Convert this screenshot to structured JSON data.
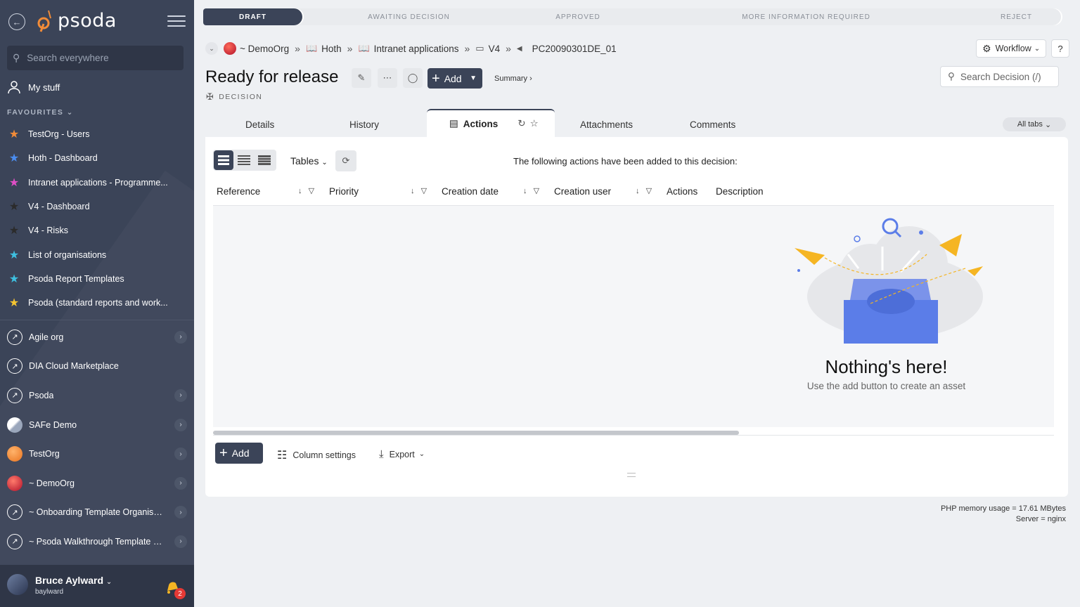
{
  "app": {
    "logo_text": "psoda"
  },
  "sidebar": {
    "search_placeholder": "Search everywhere",
    "my_stuff": "My stuff",
    "favourites_heading": "FAVOURITES",
    "favourites": [
      {
        "label": "TestOrg - Users",
        "star_color": "#f28c38"
      },
      {
        "label": "Hoth - Dashboard",
        "star_color": "#4a8df0"
      },
      {
        "label": "Intranet applications - Programme...",
        "star_color": "#e04fc6"
      },
      {
        "label": "V4 - Dashboard",
        "star_color": "#2b2b2b"
      },
      {
        "label": "V4 - Risks",
        "star_color": "#2b2b2b"
      },
      {
        "label": "List of organisations",
        "star_color": "#3ec0e0"
      },
      {
        "label": "Psoda Report Templates",
        "star_color": "#3ec0e0"
      },
      {
        "label": "Psoda (standard reports and work...",
        "star_color": "#f5c531"
      }
    ],
    "orgs": [
      {
        "label": "Agile org",
        "icon": "compass-icon",
        "has_chevron": true
      },
      {
        "label": "DIA Cloud Marketplace",
        "icon": "compass-icon",
        "has_chevron": false
      },
      {
        "label": "Psoda",
        "icon": "compass-icon",
        "has_chevron": true
      },
      {
        "label": "SAFe Demo",
        "icon": "safe-logo-icon",
        "has_chevron": true
      },
      {
        "label": "TestOrg",
        "icon": "orange-ball-icon",
        "has_chevron": true
      },
      {
        "label": "~ DemoOrg",
        "icon": "red-ball-icon",
        "has_chevron": true
      },
      {
        "label": "~ Onboarding Template Organisa...",
        "icon": "compass-icon",
        "has_chevron": true
      },
      {
        "label": "~ Psoda Walkthrough Template P...",
        "icon": "compass-icon",
        "has_chevron": true
      }
    ],
    "user": {
      "name": "Bruce Aylward",
      "username": "baylward",
      "notifications": "2"
    }
  },
  "workflow": {
    "steps": [
      "DRAFT",
      "AWAITING DECISION",
      "APPROVED",
      "MORE INFORMATION REQUIRED",
      "REJECT"
    ],
    "active": "DRAFT"
  },
  "breadcrumb": {
    "items": [
      "~ DemoOrg",
      "Hoth",
      "Intranet applications",
      "V4"
    ],
    "current": "PC20090301DE_01"
  },
  "header": {
    "workflow_button": "Workflow",
    "help": "?",
    "title": "Ready for release",
    "add_label": "Add",
    "summary_link": "Summary ›",
    "type": "DECISION",
    "search_placeholder": "Search Decision (/)"
  },
  "tabs": {
    "items": [
      "Details",
      "History",
      "Actions",
      "Attachments",
      "Comments"
    ],
    "active": "Actions",
    "all_tabs": "All tabs"
  },
  "panel": {
    "tables_label": "Tables",
    "message": "The following actions have been added to this decision:",
    "columns": [
      "Reference",
      "Priority",
      "Creation date",
      "Creation user",
      "Actions",
      "Description"
    ],
    "empty_title": "Nothing's here!",
    "empty_subtitle": "Use the add button to create an asset",
    "add_label": "Add",
    "column_settings": "Column settings",
    "export": "Export"
  },
  "footer": {
    "memory": "PHP memory usage = 17.61 MBytes",
    "server": "Server = nginx"
  },
  "colors": {
    "sidebar": "#3b4458",
    "accent_dark": "#3b4458",
    "empty_box": "#5b7de8",
    "plane": "#f5b523"
  }
}
